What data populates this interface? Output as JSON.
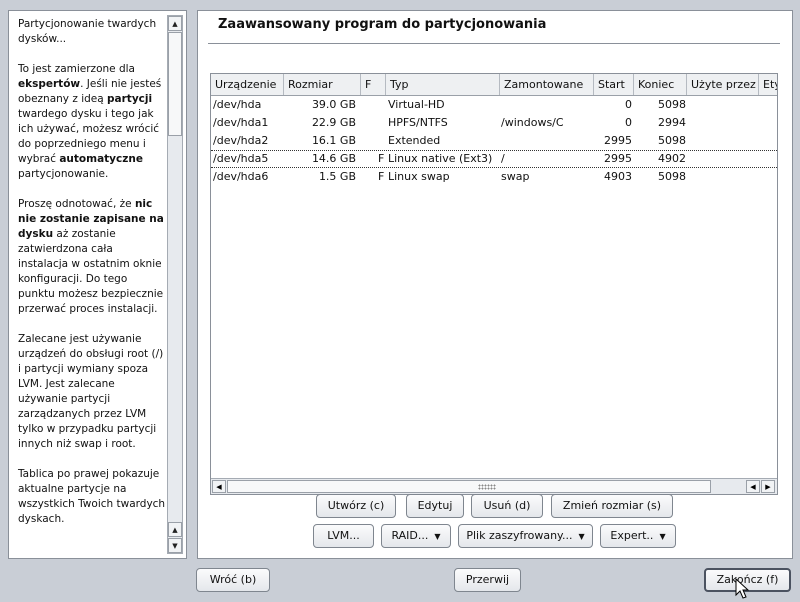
{
  "help": {
    "paragraphs": [
      [
        {
          "t": "Partycjonowanie twardych dysków..."
        }
      ],
      [
        {
          "t": "To jest zamierzone dla "
        },
        {
          "t": "ekspertów",
          "b": true
        },
        {
          "t": ". Jeśli nie jesteś obeznany z ideą "
        },
        {
          "t": "partycji",
          "b": true
        },
        {
          "t": " twardego dysku i tego jak ich używać, możesz wrócić do poprzedniego menu i wybrać "
        },
        {
          "t": "automatyczne",
          "b": true
        },
        {
          "t": " partycjonowanie."
        }
      ],
      [
        {
          "t": "Proszę odnotować, że "
        },
        {
          "t": "nic nie zostanie zapisane na dysku",
          "b": true
        },
        {
          "t": " aż zostanie zatwierdzona cała instalacja w ostatnim oknie konfiguracji. Do tego punktu możesz bezpiecznie przerwać proces instalacji."
        }
      ],
      [
        {
          "t": "Zalecane jest używanie urządzeń do obsługi root (/) i partycji wymiany spoza LVM. Jest zalecane używanie partycji zarządzanych przez LVM tylko w przypadku partycji innych niż swap i root."
        }
      ],
      [
        {
          "t": "Tablica po prawej pokazuje aktualne partycje na wszystkich Twoich twardych dyskach."
        }
      ]
    ]
  },
  "main": {
    "title": "Zaawansowany program do partycjonowania",
    "columns": [
      "Urządzenie",
      "Rozmiar",
      "F",
      "Typ",
      "Zamontowane",
      "Start",
      "Koniec",
      "Użyte przez",
      "Ety"
    ],
    "rows": [
      {
        "device": "/dev/hda",
        "size": "39.0 GB",
        "f": "",
        "type": "Virtual-HD",
        "mount": "",
        "start": "0",
        "end": "5098"
      },
      {
        "device": "/dev/hda1",
        "size": "22.9 GB",
        "f": "",
        "type": "HPFS/NTFS",
        "mount": "/windows/C",
        "start": "0",
        "end": "2994"
      },
      {
        "device": "/dev/hda2",
        "size": "16.1 GB",
        "f": "",
        "type": "Extended",
        "mount": "",
        "start": "2995",
        "end": "5098"
      },
      {
        "device": "/dev/hda5",
        "size": "14.6 GB",
        "f": "F",
        "type": "Linux native (Ext3)",
        "mount": "/",
        "start": "2995",
        "end": "4902"
      },
      {
        "device": "/dev/hda6",
        "size": "1.5 GB",
        "f": "F",
        "type": "Linux swap",
        "mount": "swap",
        "start": "4903",
        "end": "5098"
      }
    ],
    "buttons_row1": {
      "create": "Utwórz (c)",
      "edit": "Edytuj",
      "delete": "Usuń (d)",
      "resize": "Zmień rozmiar (s)"
    },
    "buttons_row2": {
      "lvm": "LVM...",
      "raid": "RAID...",
      "crypt": "Plik zaszyfrowany...",
      "expert": "Expert.."
    }
  },
  "footer": {
    "back": "Wróć (b)",
    "abort": "Przerwij",
    "finish": "Zakończ (f)"
  }
}
